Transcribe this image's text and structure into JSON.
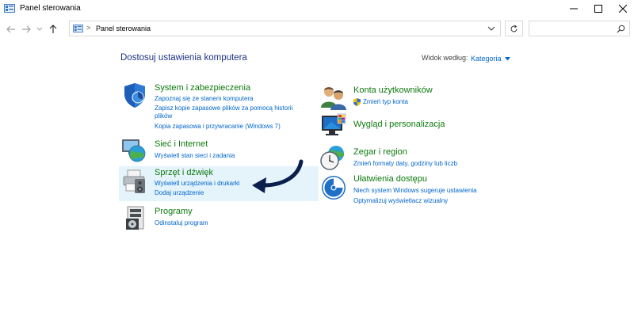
{
  "window": {
    "title": "Panel sterowania"
  },
  "address": {
    "crumb_sep": ">",
    "path": "Panel sterowania"
  },
  "search": {
    "placeholder": "",
    "value": ""
  },
  "main": {
    "heading": "Dostosuj ustawienia komputera",
    "view_by_label": "Widok według:",
    "view_by_value": "Kategoria"
  },
  "categories": [
    {
      "title": "System i zabezpieczenia",
      "icon": "shield-icon",
      "links": [
        "Zapoznaj się ze stanem komputera",
        "Zapisz kopie zapasowe plików za pomocą historii",
        "plików",
        "Kopia zapasowa i przywracanie (Windows 7)"
      ]
    },
    {
      "title": "Sieć i Internet",
      "icon": "network-globe-icon",
      "links": [
        "Wyświetl stan sieci i zadania"
      ]
    },
    {
      "title": "Sprzęt i dźwięk",
      "icon": "printer-speaker-icon",
      "links": [
        "Wyświetl urządzenia i drukarki",
        "Dodaj urządzenie"
      ]
    },
    {
      "title": "Programy",
      "icon": "programs-icon",
      "links": [
        "Odinstaluj program"
      ]
    },
    {
      "title": "Konta użytkowników",
      "icon": "users-icon",
      "links": [
        "Zmień typ konta"
      ]
    },
    {
      "title": "Wygląd i personalizacja",
      "icon": "monitor-palette-icon",
      "links": []
    },
    {
      "title": "Zegar i region",
      "icon": "clock-globe-icon",
      "links": [
        "Zmień formaty daty, godziny lub liczb"
      ]
    },
    {
      "title": "Ułatwienia dostępu",
      "icon": "accessibility-icon",
      "links": [
        "Niech system Windows sugeruje ustawienia",
        "Optymalizuj wyświetlacz wizualny"
      ]
    }
  ],
  "colors": {
    "category_title": "#0e7a0e",
    "link": "#0066cc",
    "heading": "#1e3287",
    "highlight": "#e5f3fb",
    "arrow": "#0b1f4d"
  }
}
